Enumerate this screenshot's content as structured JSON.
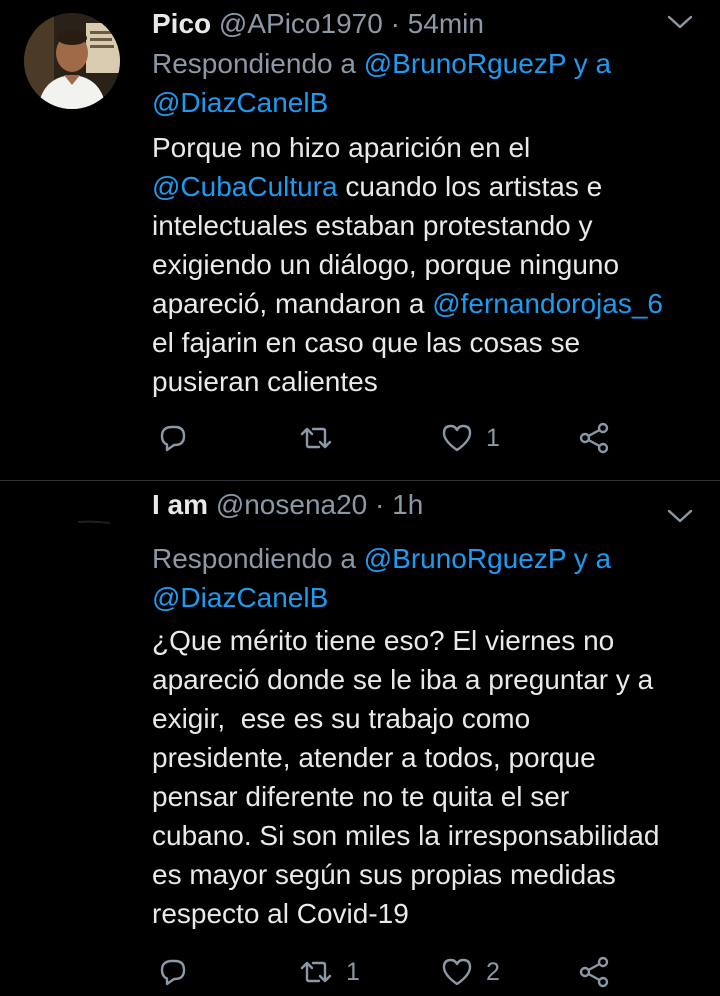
{
  "tweets": [
    {
      "name": "Pico",
      "handle": "@APico1970",
      "separator": "·",
      "time": "54min",
      "replying_prefix": "Respondiendo a",
      "replying_to_1": "@BrunoRguezP",
      "replying_and": "y a",
      "replying_to_2": "@DiazCanelB",
      "body": [
        {
          "text": "Porque no hizo aparición en el",
          "link": null
        },
        {
          "text": " cuando los artistas e",
          "link": "@CubaCultura"
        },
        {
          "text": "intelectuales estaban protestando y",
          "link": null
        },
        {
          "text": "exigiendo un diálogo, porque ninguno",
          "link": null
        },
        {
          "text": "apareció, mandaron a ",
          "link_after": "@fernandorojas_6"
        },
        {
          "text": "el fajarin en caso que las cosas se",
          "link": null
        },
        {
          "text": "pusieran calientes",
          "link": null
        }
      ],
      "actions": {
        "reply_count": "",
        "retweet_count": "",
        "like_count": "1"
      }
    },
    {
      "name": "I am",
      "handle": "@nosena20",
      "separator": "·",
      "time": "1h",
      "replying_prefix": "Respondiendo a",
      "replying_to_1": "@BrunoRguezP",
      "replying_and": "y a",
      "replying_to_2": "@DiazCanelB",
      "body_lines": [
        "¿Que mérito tiene eso? El viernes no",
        "apareció donde se le iba a preguntar y a",
        "exigir,  ese es su trabajo como",
        "presidente, atender a todos, porque",
        "pensar diferente no te quita el ser",
        "cubano. Si son miles la irresponsabilidad",
        "es mayor según sus propias medidas",
        "respecto al Covid-19"
      ],
      "actions": {
        "reply_count": "",
        "retweet_count": "1",
        "like_count": "2"
      }
    }
  ],
  "icons": {
    "reply": "reply-icon",
    "retweet": "retweet-icon",
    "like": "heart-icon",
    "share": "share-icon",
    "menu": "chevron-down-icon"
  },
  "colors": {
    "background": "#000000",
    "text": "#e7e9ea",
    "secondary": "#8b98a5",
    "link": "#1d9bf0",
    "divider": "#2f3336"
  }
}
